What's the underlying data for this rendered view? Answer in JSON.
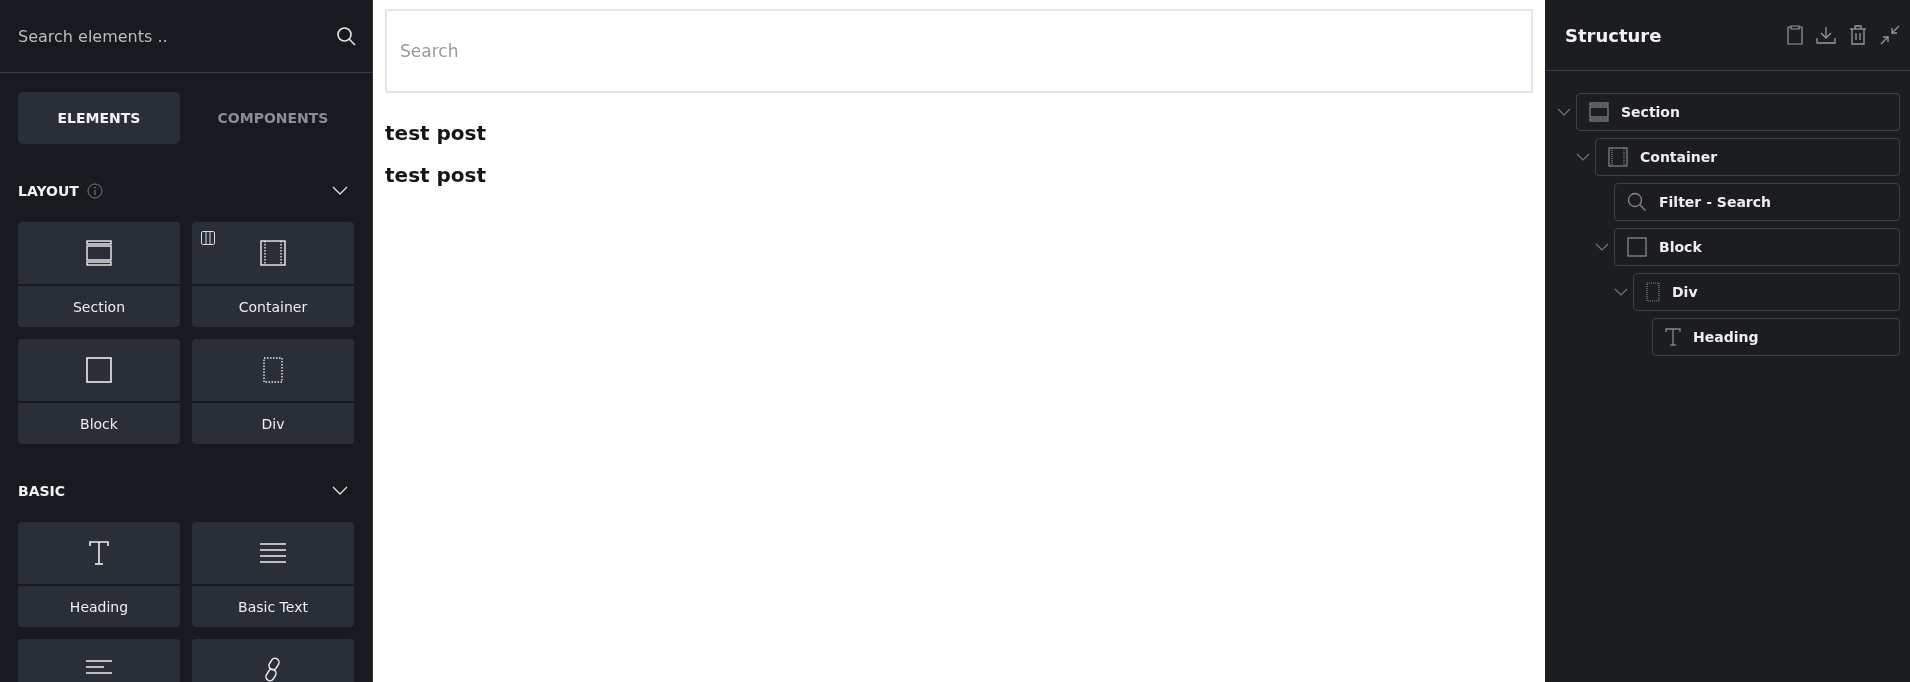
{
  "sidebar": {
    "search": {
      "placeholder": "Search elements .."
    },
    "tabs": [
      {
        "label": "ELEMENTS",
        "selected": true
      },
      {
        "label": "COMPONENTS",
        "selected": false
      }
    ],
    "groups": [
      {
        "title": "LAYOUT",
        "info": true,
        "expanded": true,
        "elements": [
          {
            "label": "Section",
            "kind": "section"
          },
          {
            "label": "Container",
            "kind": "container"
          },
          {
            "label": "Block",
            "kind": "block"
          },
          {
            "label": "Div",
            "kind": "div"
          }
        ]
      },
      {
        "title": "BASIC",
        "info": false,
        "expanded": true,
        "elements": [
          {
            "label": "Heading",
            "kind": "heading"
          },
          {
            "label": "Basic Text",
            "kind": "basictext"
          },
          {
            "kind": "text"
          },
          {
            "kind": "link"
          }
        ]
      }
    ]
  },
  "canvas": {
    "search": {
      "placeholder": "Search"
    },
    "headings": [
      "test post",
      "test post"
    ]
  },
  "structure": {
    "title": "Structure",
    "tree": [
      {
        "label": "Section",
        "kind": "section",
        "expanded": true,
        "children": [
          {
            "label": "Container",
            "kind": "container",
            "expanded": true,
            "children": [
              {
                "label": "Filter - Search",
                "kind": "search"
              },
              {
                "label": "Block",
                "kind": "block",
                "expanded": true,
                "children": [
                  {
                    "label": "Div",
                    "kind": "div",
                    "expanded": true,
                    "children": [
                      {
                        "label": "Heading",
                        "kind": "heading"
                      }
                    ]
                  }
                ]
              }
            ]
          }
        ]
      }
    ]
  }
}
